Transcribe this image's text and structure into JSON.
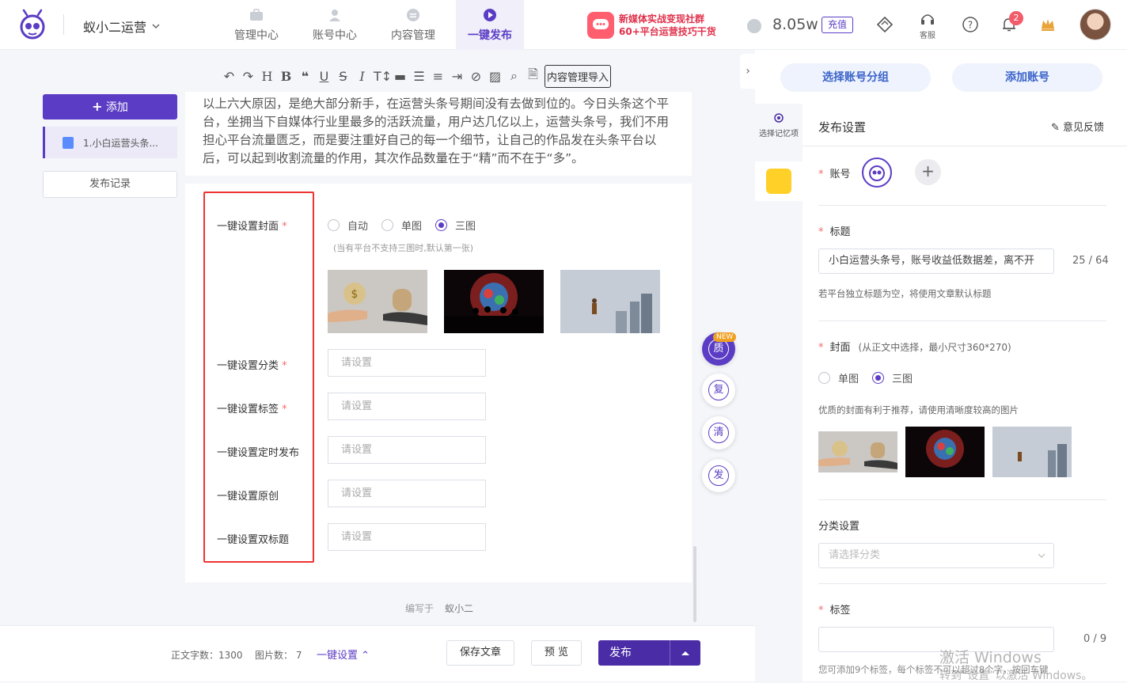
{
  "app": {
    "brand_name": "蚁小二运营"
  },
  "nav": [
    {
      "label": "管理中心",
      "icon": "briefcase-icon"
    },
    {
      "label": "账号中心",
      "icon": "user-icon"
    },
    {
      "label": "内容管理",
      "icon": "document-icon"
    },
    {
      "label": "一键发布",
      "icon": "play-icon"
    }
  ],
  "promo": {
    "line1": "新媒体实战变现社群",
    "line2": "60+平台运营技巧干货"
  },
  "header": {
    "coin_value": "8.05w",
    "recharge_label": "充值",
    "service_label": "客服",
    "notification_count": "2"
  },
  "left_panel": {
    "add_label": "添加",
    "article_item": "1.小白运营头条...",
    "publish_records": "发布记录"
  },
  "toolbar": {
    "icons": [
      "undo-icon",
      "redo-icon",
      "heading-icon",
      "bold-icon",
      "quote-icon",
      "underline-icon",
      "strikethrough-icon",
      "italic-icon",
      "text-size-icon",
      "divider-icon",
      "list-icon",
      "align-icon",
      "indent-icon",
      "clear-format-icon",
      "image-icon",
      "search-icon",
      "import-doc-icon"
    ],
    "import_label": "内容管理导入"
  },
  "content": {
    "text": "以上六大原因，是绝大部分新手，在运营头条号期间没有去做到位的。今日头条这个平台，坐拥当下自媒体行业里最多的活跃流量，用户达几亿以上，运营头条号，我们不用担心平台流量匮乏，而是要注重好自己的每一个细节，让自己的作品发在头条平台以后，可以起到收割流量的作用，其次作品数量在于“精”而不在于“多”。"
  },
  "one_click": {
    "cover_label": "一键设置封面",
    "cover_options": [
      "自动",
      "单图",
      "三图"
    ],
    "cover_selected": "三图",
    "cover_hint": "(当有平台不支持三图时,默认第一张)",
    "category_label": "一键设置分类",
    "tags_label": "一键设置标签",
    "schedule_label": "一键设置定时发布",
    "original_label": "一键设置原创",
    "double_title_label": "一键设置双标题",
    "placeholder": "请设置"
  },
  "fab": {
    "new_tag": "NEW",
    "items": [
      "质",
      "复",
      "清",
      "发"
    ]
  },
  "editor_footer": {
    "written_by": "编写于",
    "author": "蚁小二"
  },
  "bottom_bar": {
    "word_count_label": "正文字数：1300",
    "image_count_label": "图片数： 7",
    "one_click_label": "一键设置",
    "save_label": "保存文章",
    "preview_label": "预 览",
    "publish_label": "发布"
  },
  "right_panel": {
    "select_group_label": "选择账号分组",
    "add_account_label": "添加账号",
    "memory_label": "选择记忆项",
    "heading": "发布设置",
    "feedback_label": "意见反馈",
    "account_label": "账号",
    "title_label": "标题",
    "title_value": "小白运营头条号，账号收益低数据差，离不开",
    "title_count": "25 / 64",
    "title_hint": "若平台独立标题为空，将使用文章默认标题",
    "cover_label": "封面",
    "cover_note": "(从正文中选择，最小尺寸360*270)",
    "cover_options": [
      "单图",
      "三图"
    ],
    "cover_selected": "三图",
    "cover_tip": "优质的封面有利于推荐，请使用清晰度较高的图片",
    "category_label": "分类设置",
    "category_placeholder": "请选择分类",
    "tags_label": "标签",
    "tags_count": "0 / 9",
    "tags_hint": "您可添加9个标签，每个标签不可以超过8个字，按回车键"
  },
  "watermark": {
    "line1": "激活 Windows",
    "line2": "转到“设置”以激活 Windows。"
  },
  "colors": {
    "accent": "#5b3cc4",
    "required": "#f56c6c",
    "highlight_box": "#ee3333"
  }
}
